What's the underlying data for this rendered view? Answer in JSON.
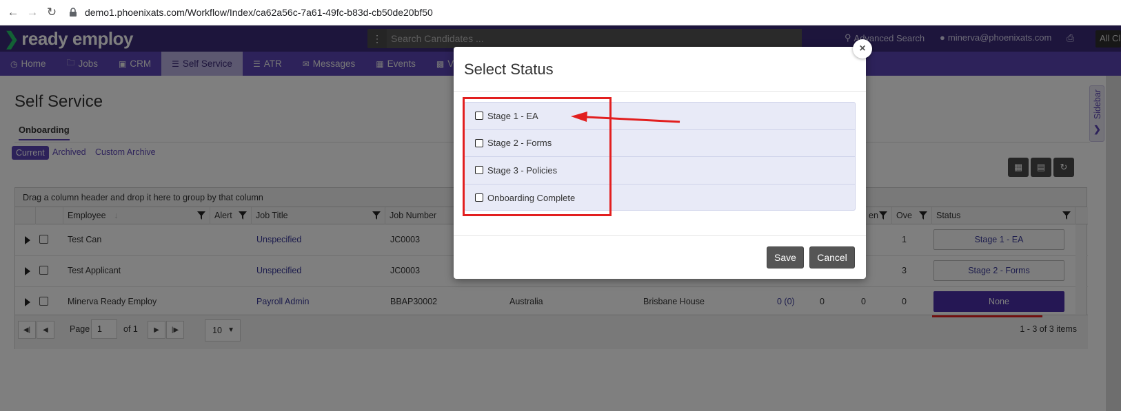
{
  "browser": {
    "url": "demo1.phoenixats.com/Workflow/Index/ca62a56c-7a61-49fc-b83d-cb50de20bf50"
  },
  "header": {
    "brand": "ready employ",
    "search_placeholder": "Search Candidates ...",
    "advanced_search": "Advanced Search",
    "user": "minerva@phoenixats.com",
    "clients": "All Clients"
  },
  "nav": {
    "items": [
      {
        "label": "Home",
        "icon": "clock-icon"
      },
      {
        "label": "Jobs",
        "icon": "folder-icon"
      },
      {
        "label": "CRM",
        "icon": "briefcase-icon"
      },
      {
        "label": "Self Service",
        "icon": "list-icon"
      },
      {
        "label": "ATR",
        "icon": "list-icon"
      },
      {
        "label": "Messages",
        "icon": "envelope-icon"
      },
      {
        "label": "Events",
        "icon": "calendar-icon"
      },
      {
        "label": "V",
        "icon": "video-icon"
      }
    ]
  },
  "page": {
    "title": "Self Service",
    "sub_tab": "Onboarding",
    "filters": [
      "Current",
      "Archived",
      "Custom Archive"
    ]
  },
  "grid": {
    "group_hint": "Drag a column header and drop it here to group by that column",
    "columns": [
      "Employee",
      "Alert",
      "Job Title",
      "Job Number",
      "en",
      "Ove",
      "Status"
    ],
    "rows": [
      {
        "employee": "Test Can",
        "job_title": "Unspecified",
        "job_number": "JC0003",
        "country": "",
        "location": "",
        "col_a": "",
        "col_b": "",
        "col_c": "",
        "ove": "1",
        "status": "Stage 1 - EA"
      },
      {
        "employee": "Test Applicant",
        "job_title": "Unspecified",
        "job_number": "JC0003",
        "country": "",
        "location": "",
        "col_a": "",
        "col_b": "",
        "col_c": "",
        "ove": "3",
        "status": "Stage 2 - Forms"
      },
      {
        "employee": "Minerva Ready Employ",
        "job_title": "Payroll Admin",
        "job_number": "BBAP30002",
        "country": "Australia",
        "location": "Brisbane House",
        "col_a": "0 (0)",
        "col_b": "0",
        "col_c": "0",
        "ove": "0",
        "status": "None"
      }
    ],
    "pager": {
      "page_label": "Page",
      "page": "1",
      "of_label": "of 1",
      "page_size": "10",
      "items": "1 - 3 of 3 items"
    }
  },
  "sidebar": {
    "label": "Sidebar"
  },
  "modal": {
    "title": "Select Status",
    "close": "×",
    "options": [
      "Stage 1 - EA",
      "Stage 2 - Forms",
      "Stage 3 - Policies",
      "Onboarding Complete"
    ],
    "save": "Save",
    "cancel": "Cancel"
  }
}
